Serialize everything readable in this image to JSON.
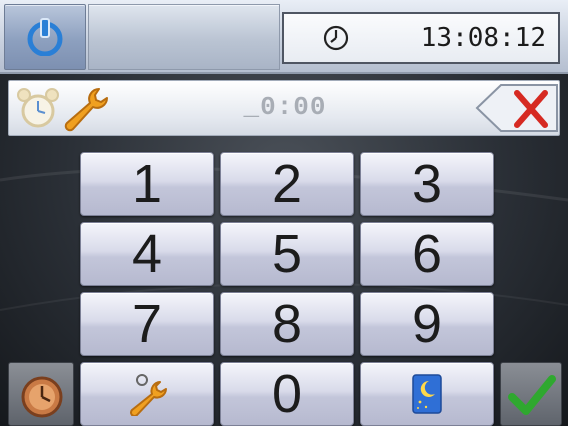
{
  "header": {
    "time": "13:08:12",
    "icons": [
      "power-icon",
      "clock-icon"
    ]
  },
  "entry": {
    "value": "_0:00",
    "icons": [
      "alarm-clock-icon",
      "wrench-icon"
    ],
    "backspace_icon": "backspace-x-icon"
  },
  "keypad": {
    "keys": [
      "1",
      "2",
      "3",
      "4",
      "5",
      "6",
      "7",
      "8",
      "9",
      "0"
    ],
    "special_icons": [
      "wrench-icon",
      "night-mode-icon"
    ]
  },
  "footer": {
    "left_icon": "timer-clock-icon",
    "right_icon": "checkmark-icon"
  },
  "colors": {
    "power_blue": "#2a7fd6",
    "cancel_red": "#d62a22",
    "confirm_green": "#2fa82f",
    "wrench_orange": "#f0a020"
  }
}
